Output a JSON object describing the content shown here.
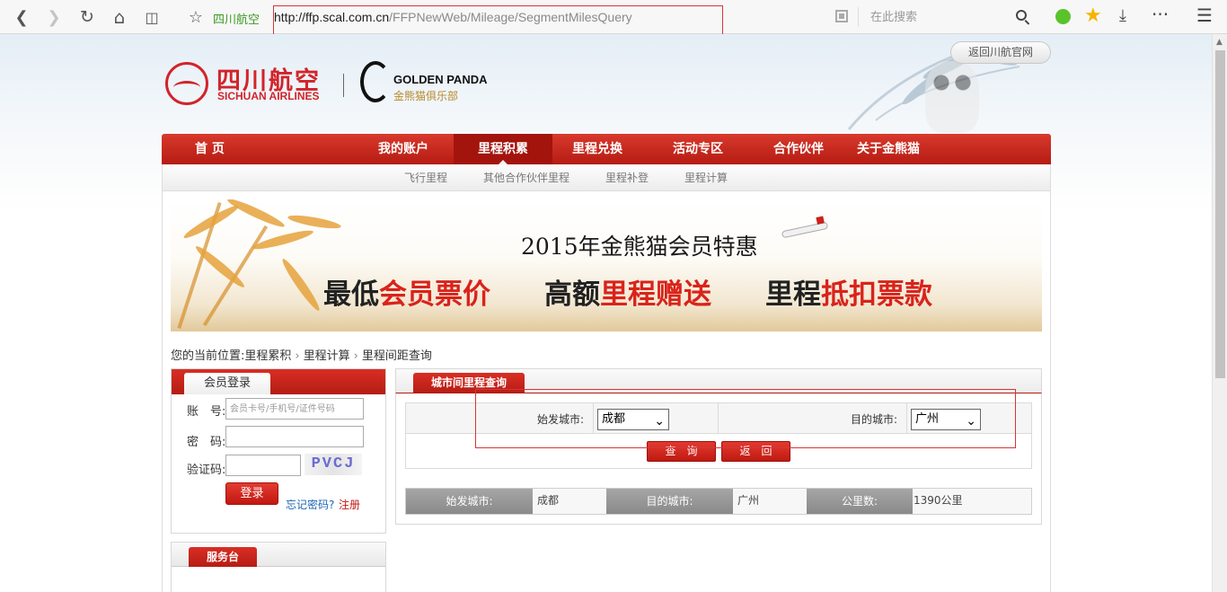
{
  "browser": {
    "site_name": "四川航空",
    "url_host": "http://ffp.scal.com.cn",
    "url_path": "/FFPNewWeb/Mileage/SegmentMilesQuery",
    "search_placeholder": "在此搜索",
    "icons": [
      "back-arrow",
      "forward-arrow",
      "reload",
      "home",
      "reader",
      "bookmark-star",
      "qr-code",
      "search",
      "wechat",
      "favorites-star",
      "download",
      "more",
      "menu"
    ]
  },
  "header": {
    "back_official_label": "返回川航官网",
    "logo_cn": "四川航空",
    "logo_en": "SICHUAN AIRLINES",
    "panda_en": "GOLDEN PANDA",
    "panda_cn": "金熊猫俱乐部"
  },
  "main_nav": {
    "items": [
      "首 页",
      "我的账户",
      "里程积累",
      "里程兑换",
      "活动专区",
      "合作伙伴",
      "关于金熊猫"
    ],
    "active_index": 2
  },
  "sub_nav": {
    "items": [
      "飞行里程",
      "其他合作伙伴里程",
      "里程补登",
      "里程计算"
    ]
  },
  "banner": {
    "title": "2015年金熊猫会员特惠",
    "line1_prefix": "最低",
    "line1_red": "会员票价",
    "line2_prefix": "高额",
    "line2_red": "里程赠送",
    "line3_prefix": "里程",
    "line3_red": "抵扣票款"
  },
  "breadcrumb": {
    "prefix": "您的当前位置:",
    "items": [
      "里程累积",
      "里程计算",
      "里程间距查询"
    ]
  },
  "login": {
    "title": "会员登录",
    "account_label": "账　号:",
    "account_placeholder": "会员卡号/手机号/证件号码",
    "password_label": "密　码:",
    "captcha_label": "验证码:",
    "captcha_text": "PVCJ",
    "login_button": "登录",
    "forgot_link": "忘记密码?",
    "register_link": "注册"
  },
  "service": {
    "title": "服务台"
  },
  "query": {
    "title": "城市间里程查询",
    "from_label": "始发城市:",
    "from_value": "成都",
    "to_label": "目的城市:",
    "to_value": "广州",
    "query_button": "查询",
    "back_button": "返回"
  },
  "result": {
    "from_label": "始发城市:",
    "from_value": "成都",
    "to_label": "目的城市:",
    "to_value": "广州",
    "distance_label": "公里数:",
    "distance_value": "1390公里"
  },
  "colors": {
    "brand_red": "#c8221b",
    "link_blue": "#1b66b2",
    "site_green": "#3c9a22",
    "annotation_red": "#d9343a"
  }
}
